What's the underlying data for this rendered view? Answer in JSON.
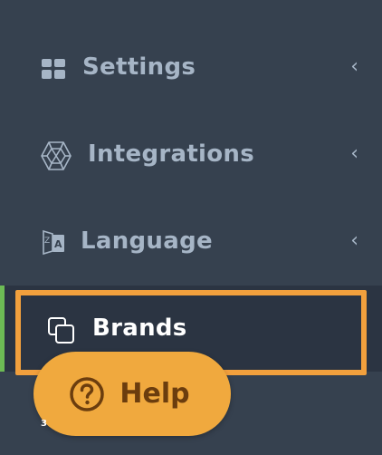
{
  "sidebar": {
    "items": [
      {
        "label": "Settings",
        "icon": "grid-icon",
        "chevron": "‹"
      },
      {
        "label": "Integrations",
        "icon": "polyhedron-icon",
        "chevron": "‹"
      },
      {
        "label": "Language",
        "icon": "translate-icon",
        "chevron": "‹"
      },
      {
        "label": "Brands",
        "icon": "copy-icon",
        "active": true
      }
    ]
  },
  "help": {
    "label": "Help"
  },
  "badge": {
    "text": "3"
  },
  "colors": {
    "background": "#36414f",
    "active_background": "#2b3442",
    "active_indicator": "#6dbb55",
    "highlight": "#f2a03d",
    "help_button": "#f0a93e",
    "help_text": "#6b3d0e",
    "nav_text": "#a6b5c6"
  }
}
